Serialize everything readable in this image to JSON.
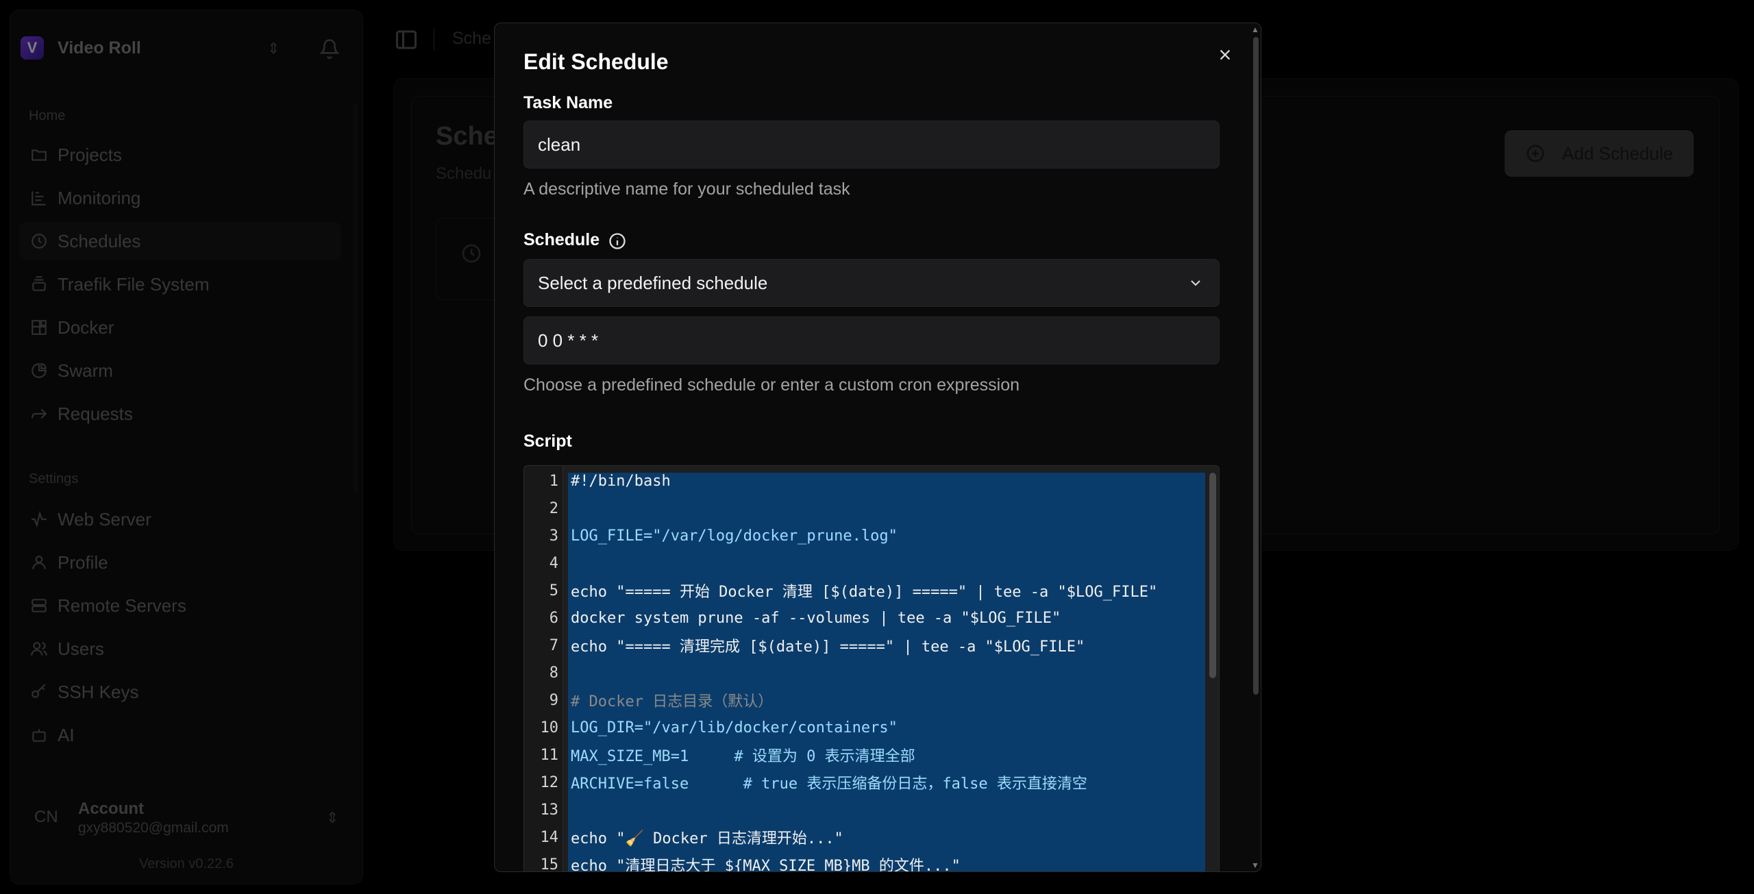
{
  "app": {
    "name": "Video Roll",
    "logo_letter": "V",
    "version": "Version v0.22.6"
  },
  "sidebar": {
    "home_label": "Home",
    "settings_label": "Settings",
    "home_items": [
      {
        "label": "Projects",
        "icon": "folder-icon"
      },
      {
        "label": "Monitoring",
        "icon": "chart-icon"
      },
      {
        "label": "Schedules",
        "icon": "clock-icon",
        "active": true
      },
      {
        "label": "Traefik File System",
        "icon": "server-stack-icon"
      },
      {
        "label": "Docker",
        "icon": "blocks-icon"
      },
      {
        "label": "Swarm",
        "icon": "pie-icon"
      },
      {
        "label": "Requests",
        "icon": "forward-arrow-icon"
      }
    ],
    "settings_items": [
      {
        "label": "Web Server",
        "icon": "activity-icon"
      },
      {
        "label": "Profile",
        "icon": "user-icon"
      },
      {
        "label": "Remote Servers",
        "icon": "server-icon"
      },
      {
        "label": "Users",
        "icon": "users-icon"
      },
      {
        "label": "SSH Keys",
        "icon": "key-icon"
      },
      {
        "label": "AI",
        "icon": "bot-icon"
      }
    ],
    "account": {
      "avatar": "CN",
      "name": "Account",
      "email": "gxy880520@gmail.com"
    }
  },
  "topbar": {
    "breadcrumb": "Sche"
  },
  "page": {
    "title": "Sche",
    "subtitle": "Schedu",
    "add_button": "Add Schedule"
  },
  "modal": {
    "title": "Edit Schedule",
    "task_name_label": "Task Name",
    "task_name_value": "clean",
    "task_name_help": "A descriptive name for your scheduled task",
    "schedule_label": "Schedule",
    "schedule_select": "Select a predefined schedule",
    "cron_value": "0 0 * * *",
    "schedule_help": "Choose a predefined schedule or enter a custom cron expression",
    "script_label": "Script"
  },
  "script": {
    "line_numbers": [
      "1",
      "2",
      "3",
      "4",
      "5",
      "6",
      "7",
      "8",
      "9",
      "10",
      "11",
      "12",
      "13",
      "14",
      "15"
    ],
    "lines": [
      "#!/bin/bash",
      "",
      "LOG_FILE=\"/var/log/docker_prune.log\"",
      "",
      "echo \"===== 开始 Docker 清理 [$(date)] =====\" | tee -a \"$LOG_FILE\"",
      "docker system prune -af --volumes | tee -a \"$LOG_FILE\"",
      "echo \"===== 清理完成 [$(date)] =====\" | tee -a \"$LOG_FILE\"",
      "",
      "# Docker 日志目录（默认）",
      "LOG_DIR=\"/var/lib/docker/containers\"",
      "MAX_SIZE_MB=1     # 设置为 0 表示清理全部",
      "ARCHIVE=false      # true 表示压缩备份日志，false 表示直接清空",
      "",
      "echo \"🧹 Docker 日志清理开始...\"",
      "echo \"清理日志大于 ${MAX_SIZE_MB}MB 的文件...\""
    ]
  },
  "colors": {
    "selection": "#0a3c6b",
    "modal_bg": "#0a0a0a",
    "input_bg": "#1c1c1e",
    "brand": "#7b3fe4"
  }
}
